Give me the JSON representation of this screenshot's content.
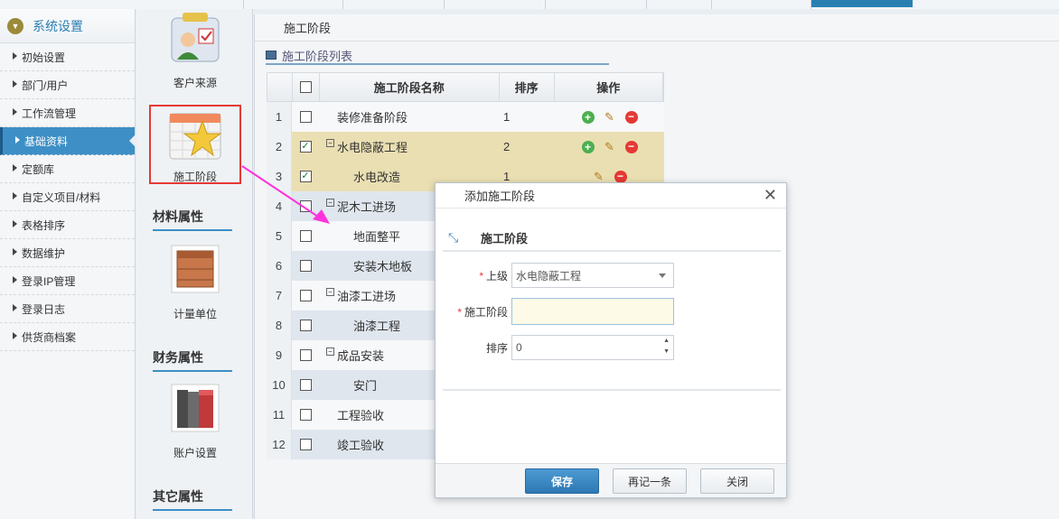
{
  "sidebar": {
    "title": "系统设置",
    "items": [
      {
        "label": "初始设置",
        "active": false
      },
      {
        "label": "部门/用户",
        "active": false
      },
      {
        "label": "工作流管理",
        "active": false
      },
      {
        "label": "基础资料",
        "active": true
      },
      {
        "label": "定额库",
        "active": false
      },
      {
        "label": "自定义项目/材料",
        "active": false
      },
      {
        "label": "表格排序",
        "active": false
      },
      {
        "label": "数据维护",
        "active": false
      },
      {
        "label": "登录IP管理",
        "active": false
      },
      {
        "label": "登录日志",
        "active": false
      },
      {
        "label": "供货商档案",
        "active": false
      }
    ]
  },
  "icon_panel": {
    "customer_source": "客户来源",
    "construction_stage": "施工阶段",
    "material_section": "材料属性",
    "unit": "计量单位",
    "finance_section": "财务属性",
    "account": "账户设置",
    "other_section": "其它属性"
  },
  "main": {
    "tab": "施工阶段",
    "list_title": "施工阶段列表",
    "columns": {
      "name": "施工阶段名称",
      "sort": "排序",
      "ops": "操作"
    },
    "rows": [
      {
        "num": "1",
        "name": "装修准备阶段",
        "sort": "1",
        "checked": false,
        "level": 0,
        "expander": false
      },
      {
        "num": "2",
        "name": "水电隐蔽工程",
        "sort": "2",
        "checked": true,
        "level": 0,
        "expander": true
      },
      {
        "num": "3",
        "name": "水电改造",
        "sort": "1",
        "checked": true,
        "level": 1,
        "expander": false
      },
      {
        "num": "4",
        "name": "泥木工进场",
        "sort": "",
        "checked": false,
        "level": 0,
        "expander": true
      },
      {
        "num": "5",
        "name": "地面整平",
        "sort": "",
        "checked": false,
        "level": 1,
        "expander": false
      },
      {
        "num": "6",
        "name": "安装木地板",
        "sort": "",
        "checked": false,
        "level": 1,
        "expander": false
      },
      {
        "num": "7",
        "name": "油漆工进场",
        "sort": "",
        "checked": false,
        "level": 0,
        "expander": true
      },
      {
        "num": "8",
        "name": "油漆工程",
        "sort": "",
        "checked": false,
        "level": 1,
        "expander": false
      },
      {
        "num": "9",
        "name": "成品安装",
        "sort": "",
        "checked": false,
        "level": 0,
        "expander": true
      },
      {
        "num": "10",
        "name": "安门",
        "sort": "",
        "checked": false,
        "level": 1,
        "expander": false
      },
      {
        "num": "11",
        "name": "工程验收",
        "sort": "",
        "checked": false,
        "level": 0,
        "expander": false
      },
      {
        "num": "12",
        "name": "竣工验收",
        "sort": "",
        "checked": false,
        "level": 0,
        "expander": false
      }
    ]
  },
  "dialog": {
    "title": "添加施工阶段",
    "section_title": "施工阶段",
    "parent_label": "上级",
    "parent_value": "水电隐蔽工程",
    "stage_label": "施工阶段",
    "stage_value": "",
    "sort_label": "排序",
    "sort_value": "0",
    "save": "保存",
    "save_another": "再记一条",
    "close": "关闭"
  },
  "colors": {
    "accent": "#3d8fc6",
    "selected_row": "#eadfb2",
    "highlight_box": "#e53935",
    "arrow": "#ff33dd"
  }
}
